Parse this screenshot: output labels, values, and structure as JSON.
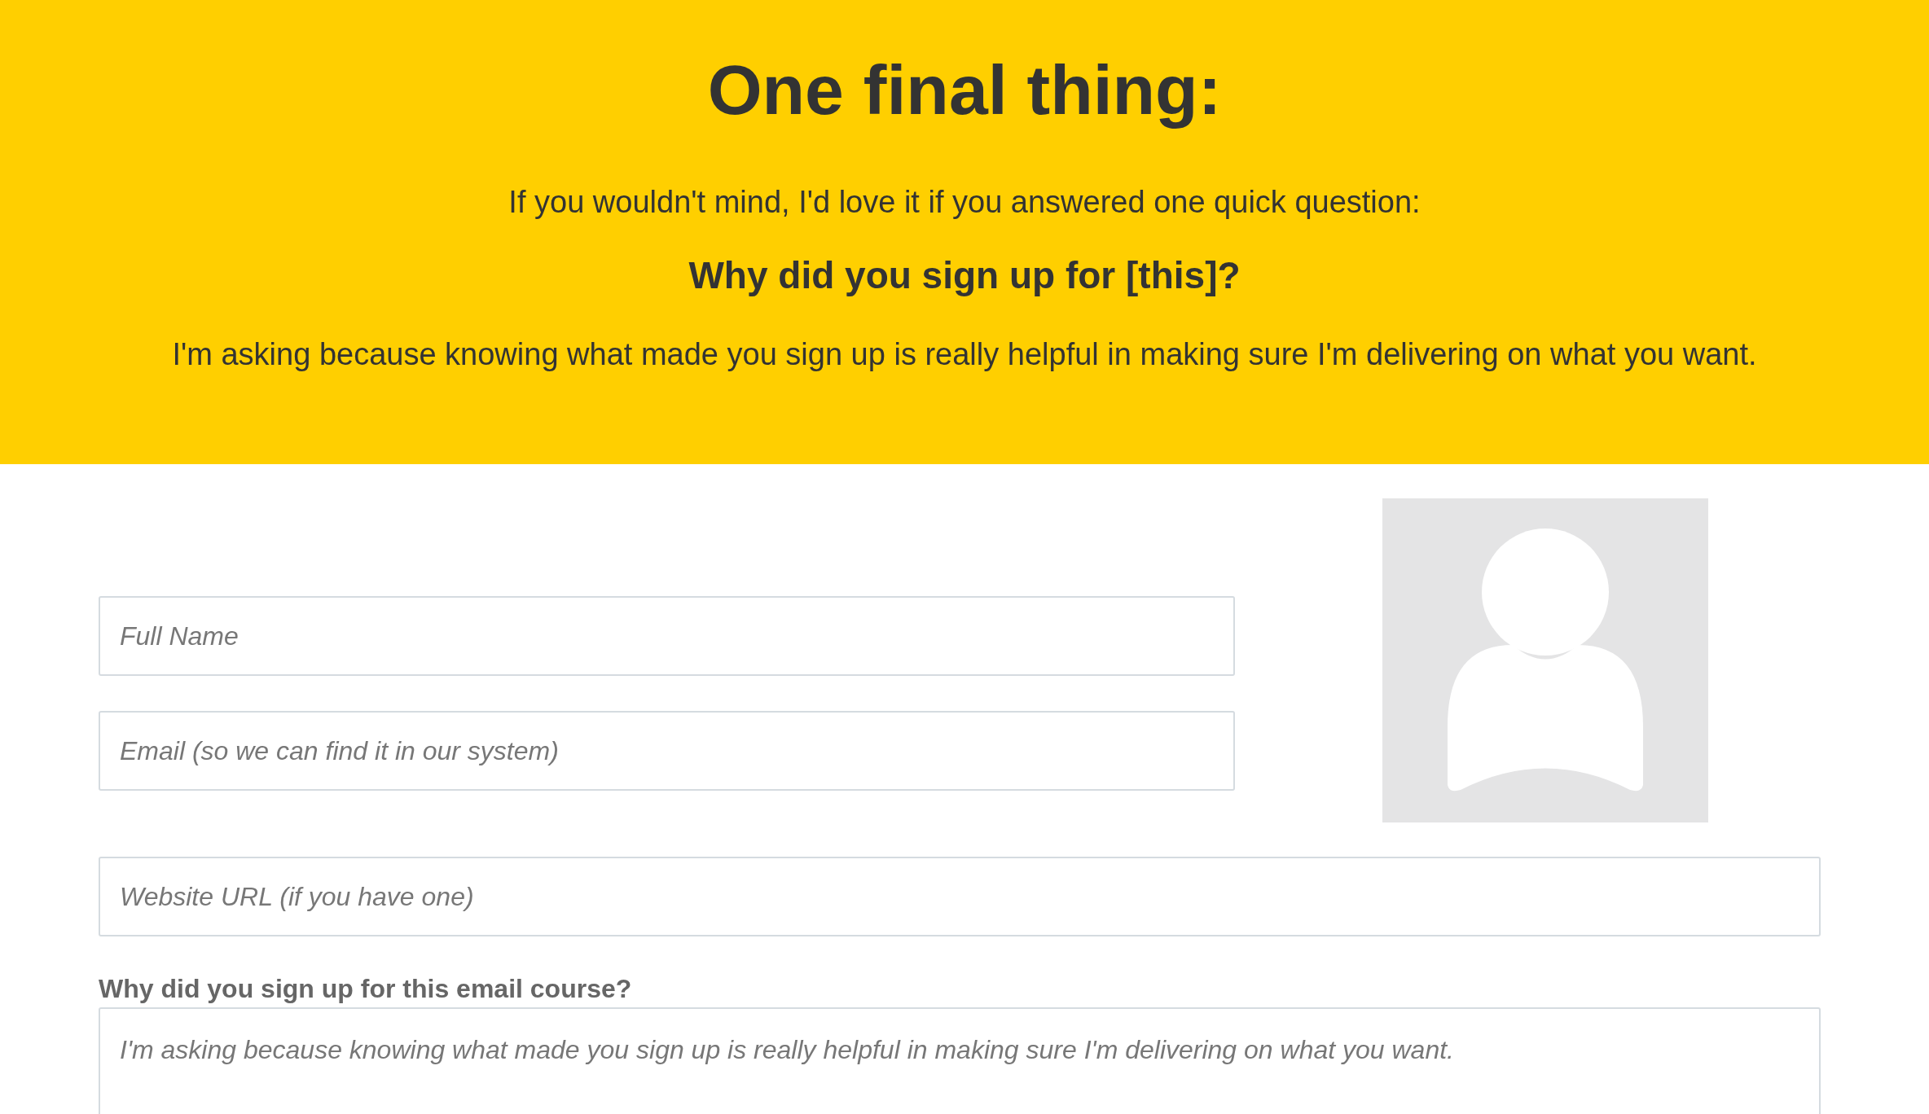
{
  "header": {
    "title": "One final thing:",
    "intro": "If you wouldn't mind, I'd love it if you answered one quick question:",
    "question": "Why did you sign up for [this]?",
    "explanation": "I'm asking because knowing what made you sign up is really helpful in making sure I'm delivering on what you want."
  },
  "form": {
    "fields": [
      {
        "placeholder": "Full Name"
      },
      {
        "placeholder": "Email (so we can find it in our system)"
      }
    ],
    "website": {
      "placeholder": "Website URL (if you have one)"
    },
    "question": {
      "label": "Why did you sign up for this email course?",
      "placeholder": "I'm asking because knowing what made you sign up is really helpful in making sure I'm delivering on what you want."
    }
  }
}
